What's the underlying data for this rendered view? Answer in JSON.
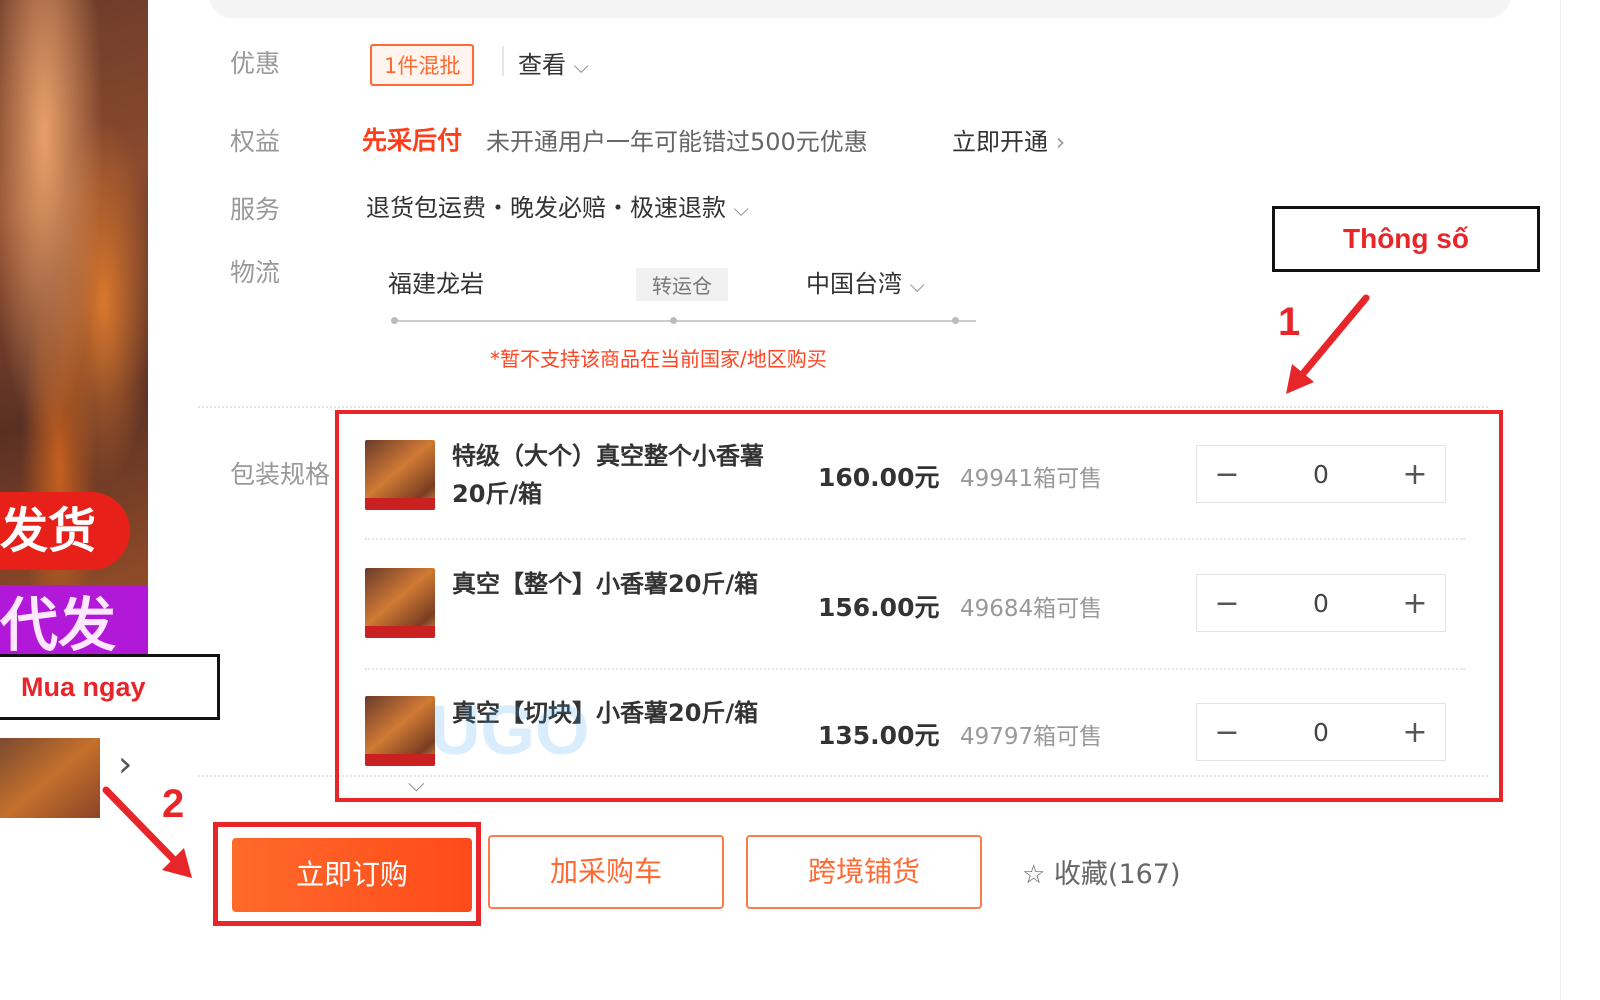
{
  "promo": {
    "label": "优惠",
    "badge": "1件混批",
    "view": "查看"
  },
  "rights": {
    "label": "权益",
    "highlight": "先采后付",
    "desc": "未开通用户一年可能错过500元优惠",
    "action": "立即开通"
  },
  "service": {
    "label": "服务",
    "items": "退货包运费・晚发必赔・极速退款"
  },
  "logistics": {
    "label": "物流",
    "from": "福建龙岩",
    "transfer": "转运仓",
    "to": "中国台湾",
    "notice": "*暂不支持该商品在当前国家/地区购买"
  },
  "specs": {
    "label": "包装规格",
    "rows": [
      {
        "name": "特级（大个）真空整个小香薯20斤/箱",
        "price": "160.00元",
        "stock": "49941箱可售",
        "qty": "0"
      },
      {
        "name": "真空【整个】小香薯20斤/箱",
        "price": "156.00元",
        "stock": "49684箱可售",
        "qty": "0"
      },
      {
        "name": "真空【切块】小香薯20斤/箱",
        "price": "135.00元",
        "stock": "49797箱可售",
        "qty": "0"
      }
    ]
  },
  "actions": {
    "buy_now": "立即订购",
    "add_cart": "加采购车",
    "cross_border": "跨境铺货",
    "favorite": "收藏(167)"
  },
  "left_banner": {
    "line1": "发货",
    "line2": "代发"
  },
  "annotations": {
    "callout_specs": "Thông số",
    "callout_buy": "Mua ngay",
    "step1": "1",
    "step2": "2"
  },
  "watermark": "UGO",
  "icons": {
    "chevron": "chevron-down-icon",
    "arrow": "chevron-right-icon",
    "star": "star-outline-icon"
  },
  "colors": {
    "accent": "#ff4a1a",
    "annotation": "#e8262a",
    "banner_red": "#e8201a",
    "banner_purple": "#b218d8"
  }
}
